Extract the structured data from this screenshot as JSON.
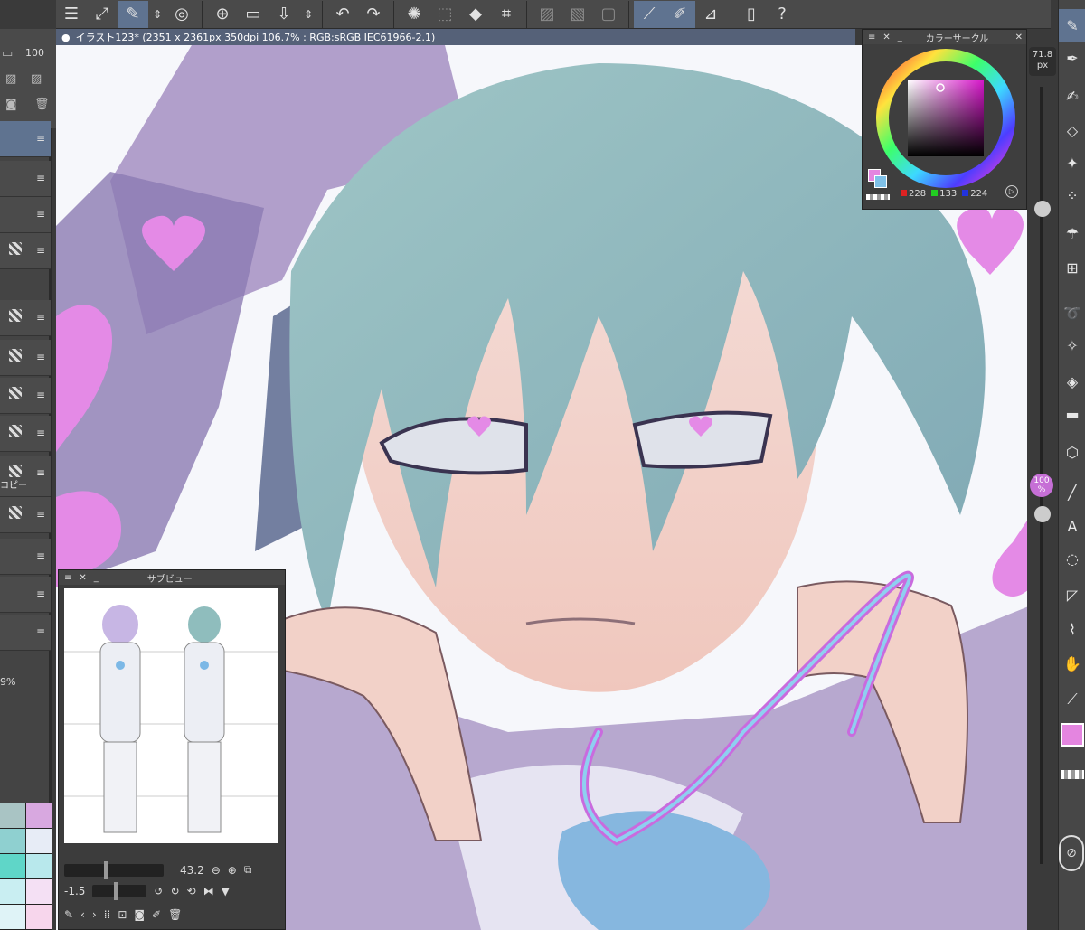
{
  "canvas": {
    "title": "イラスト123* (2351 x 2361px 350dpi 106.7% : RGB:sRGB IEC61966-2.1)"
  },
  "left_panel": {
    "opacity": "100",
    "zoom_fragment": "9%",
    "layer_label": "コピー"
  },
  "color_panel": {
    "title": "カラーサークル",
    "r": "228",
    "g": "133",
    "b": "224",
    "colors": {
      "main": "#e485e0",
      "sub": "#7fc1e8"
    }
  },
  "right_strip": {
    "brush_size": "71.8",
    "brush_unit": "px",
    "opacity_value": "100",
    "opacity_unit": "%"
  },
  "subview": {
    "title": "サブビュー",
    "zoom": "43.2",
    "rotation": "-1.5"
  },
  "toolbar": {
    "icons": [
      "menu-icon",
      "fit-icon",
      "eyedropper-icon",
      "updown-icon",
      "lasso-icon",
      "new-icon",
      "open-icon",
      "save-icon",
      "updown-icon",
      "undo-icon",
      "redo-icon",
      "loading-icon",
      "select-icon",
      "fill-icon",
      "transform-icon",
      "clear-icon",
      "grid-icon",
      "frame-icon",
      "pen-icon",
      "brush-icon",
      "ruler-icon",
      "phone-icon",
      "help-icon"
    ]
  }
}
